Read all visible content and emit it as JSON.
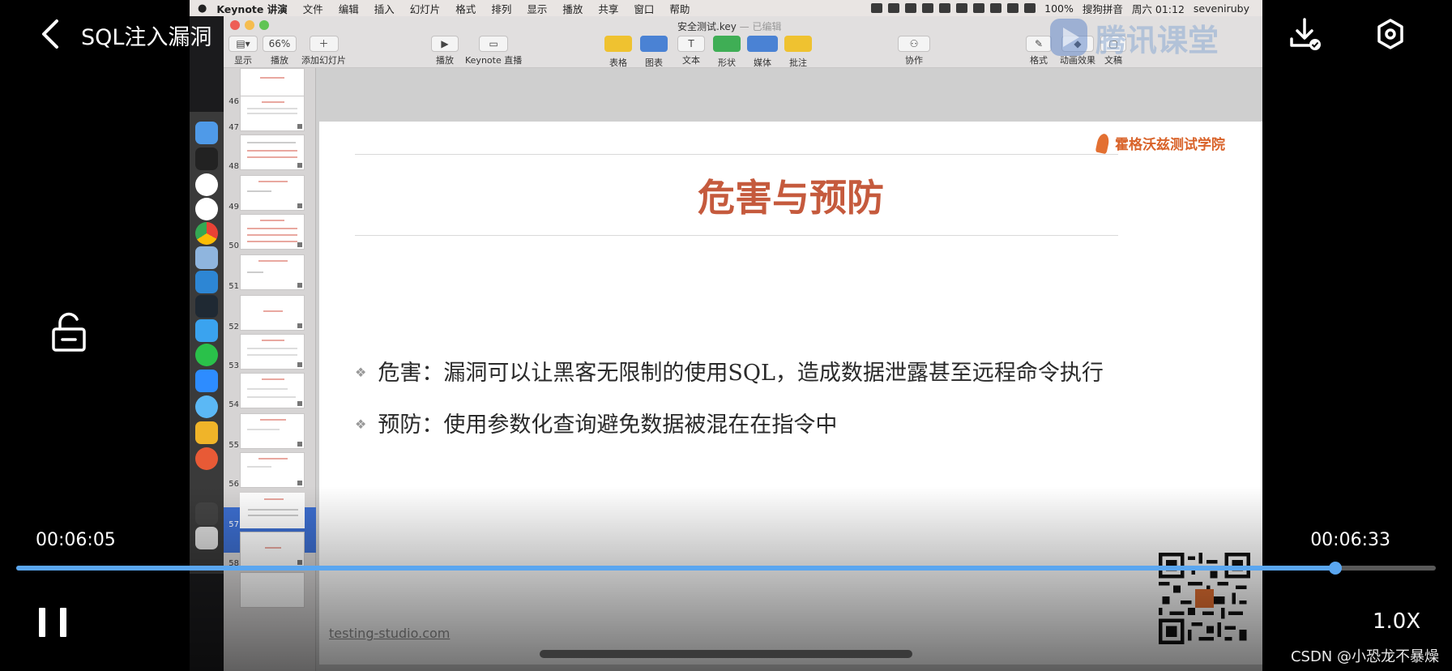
{
  "player": {
    "title": "SQL注入漏洞",
    "current_time": "00:06:05",
    "total_time": "00:06:33",
    "progress": 0.929,
    "speed": "1.0X",
    "credit": "CSDN @小恐龙不暴燥",
    "accent_color": "#5aa6f0",
    "icons": [
      "back-arrow-icon",
      "download-icon",
      "settings-icon",
      "lock-icon",
      "pause-icon"
    ]
  },
  "mac_menubar": {
    "app": "Keynote 讲演",
    "menus": [
      "文件",
      "编辑",
      "插入",
      "幻灯片",
      "格式",
      "排列",
      "显示",
      "播放",
      "共享",
      "窗口",
      "帮助"
    ],
    "battery": "100%",
    "input_method": "搜狗拼音",
    "clock": "周六 01:12",
    "user": "seveniruby"
  },
  "keynote": {
    "doc_title": "安全测试.key",
    "doc_status": "— 已编辑",
    "zoom": "66%",
    "toolbar_left": [
      "显示",
      "播放",
      "添加幻灯片"
    ],
    "toolbar_mid": [
      "播放",
      "Keynote 直播"
    ],
    "toolbar_insert": [
      "表格",
      "图表",
      "文本",
      "形状",
      "媒体",
      "批注"
    ],
    "collab": "协作",
    "toolbar_right": [
      "格式",
      "动画效果",
      "文稿"
    ],
    "slide_numbers": [
      "46",
      "47",
      "48",
      "49",
      "50",
      "51",
      "52",
      "53",
      "54",
      "55",
      "56",
      "57",
      "58"
    ],
    "selected_slide": "57"
  },
  "watermark": "腾讯课堂",
  "slide": {
    "logo_text": "霍格沃兹测试学院",
    "title": "危害与预防",
    "bullets": [
      "危害：漏洞可以让黑客无限制的使用SQL，造成数据泄露甚至远程命令执行",
      "预防：使用参数化查询避免数据被混在在指令中"
    ],
    "website": "testing-studio.com",
    "title_color": "#c55a3d",
    "logo_color": "#d9632a"
  }
}
